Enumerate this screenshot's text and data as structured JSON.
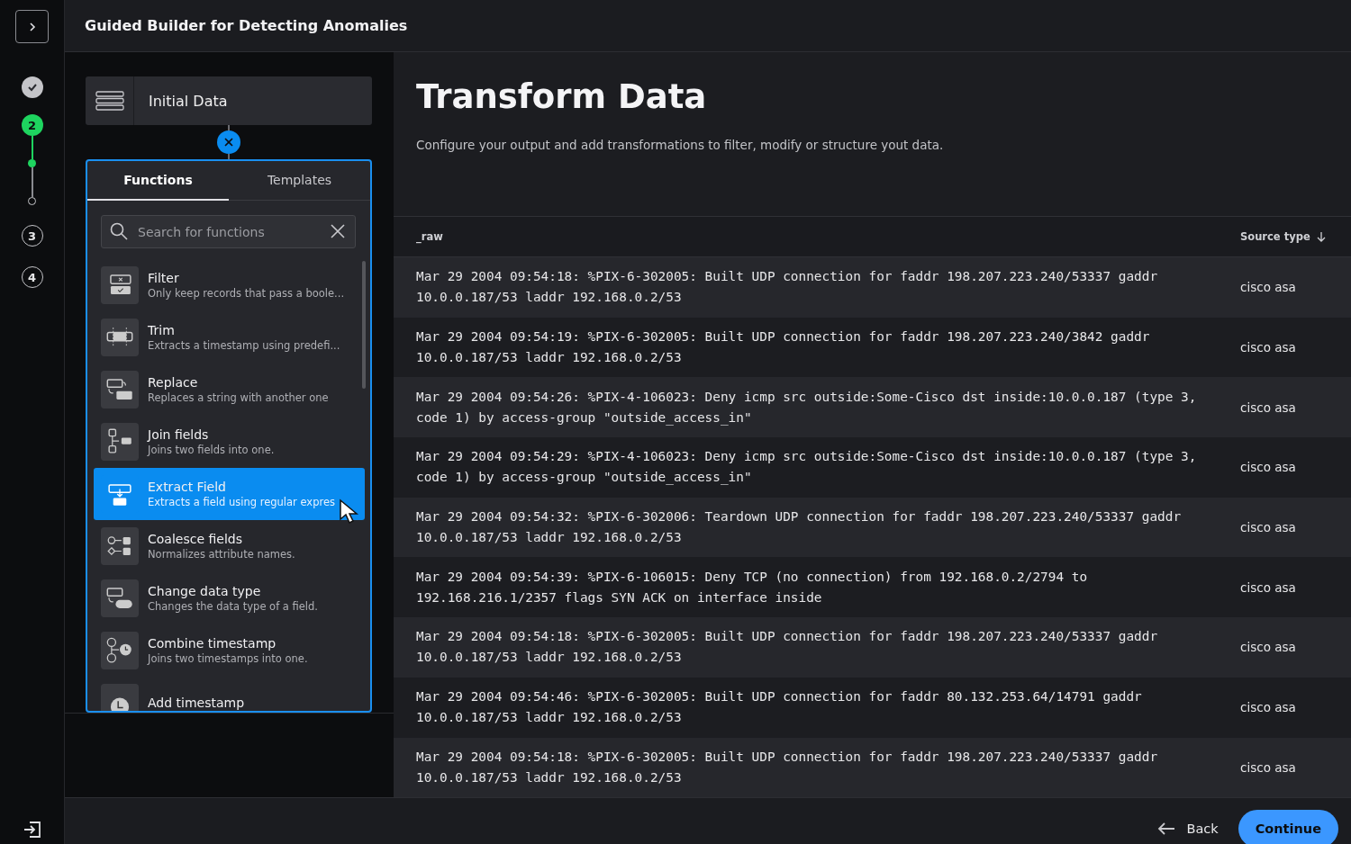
{
  "window": {
    "title": "Guided Builder for Detecting Anomalies"
  },
  "steps": [
    {
      "done": true,
      "selected": false
    },
    {
      "label": "2",
      "done": false,
      "selected": true,
      "children": [
        {
          "done": true
        },
        {
          "done": false
        }
      ]
    },
    {
      "label": "3",
      "done": false,
      "selected": false
    },
    {
      "label": "4",
      "done": false,
      "selected": false
    }
  ],
  "source_node": {
    "title": "Initial Data"
  },
  "tabs": [
    {
      "label": "Functions",
      "selected": true
    },
    {
      "label": "Templates",
      "selected": false
    }
  ],
  "search": {
    "placeholder": "Search for functions"
  },
  "functions": [
    {
      "name": "Filter",
      "description": "Only keep records that pass a boole...",
      "selected": false
    },
    {
      "name": "Trim",
      "description": "Extracts a timestamp using predefi...",
      "selected": false
    },
    {
      "name": "Replace",
      "description": "Replaces a string with another one",
      "selected": false
    },
    {
      "name": "Join fields",
      "description": "Joins two fields into one.",
      "selected": false
    },
    {
      "name": "Extract Field",
      "description": "Extracts a field using regular expres",
      "selected": true
    },
    {
      "name": "Coalesce fields",
      "description": "Normalizes attribute names.",
      "selected": false
    },
    {
      "name": "Change data type",
      "description": "Changes the data type of a field.",
      "selected": false
    },
    {
      "name": "Combine timestamp",
      "description": "Joins two timestamps into one.",
      "selected": false
    },
    {
      "name": "Add timestamp",
      "selected": false
    }
  ],
  "main": {
    "title": "Transform Data",
    "description": "Configure your output and add transformations to filter, modify or structure yout data."
  },
  "table": {
    "columns": [
      {
        "label": "_raw"
      },
      {
        "label": "Source type",
        "sort_descending": true
      }
    ],
    "rows": [
      {
        "raw": "Mar 29 2004 09:54:18: %PIX-6-302005: Built UDP connection for faddr 198.207.223.240/53337 gaddr 10.0.0.187/53 laddr 192.168.0.2/53",
        "source_type": "cisco asa"
      },
      {
        "raw": "Mar 29 2004 09:54:19: %PIX-6-302005: Built UDP connection for faddr 198.207.223.240/3842 gaddr 10.0.0.187/53 laddr 192.168.0.2/53",
        "source_type": "cisco asa"
      },
      {
        "raw": "Mar 29 2004 09:54:26: %PIX-4-106023: Deny icmp src outside:Some-Cisco dst inside:10.0.0.187 (type 3, code 1) by access-group \"outside_access_in\"",
        "source_type": "cisco asa"
      },
      {
        "raw": "Mar 29 2004 09:54:29: %PIX-4-106023: Deny icmp src outside:Some-Cisco dst inside:10.0.0.187 (type 3, code 1) by access-group \"outside_access_in\"",
        "source_type": "cisco asa"
      },
      {
        "raw": "Mar 29 2004 09:54:32: %PIX-6-302006: Teardown UDP connection for faddr 198.207.223.240/53337 gaddr 10.0.0.187/53 laddr 192.168.0.2/53",
        "source_type": "cisco asa"
      },
      {
        "raw": "Mar 29 2004 09:54:39: %PIX-6-106015: Deny TCP (no connection) from 192.168.0.2/2794 to 192.168.216.1/2357 flags SYN ACK on interface inside",
        "source_type": "cisco asa"
      },
      {
        "raw": "Mar 29 2004 09:54:18: %PIX-6-302005: Built UDP connection for faddr 198.207.223.240/53337 gaddr 10.0.0.187/53 laddr 192.168.0.2/53",
        "source_type": "cisco asa"
      },
      {
        "raw": "Mar 29 2004 09:54:46: %PIX-6-302005: Built UDP connection for faddr 80.132.253.64/14791 gaddr 10.0.0.187/53 laddr 192.168.0.2/53",
        "source_type": "cisco asa"
      },
      {
        "raw": "Mar 29 2004 09:54:18: %PIX-6-302005: Built UDP connection for faddr 198.207.223.240/53337 gaddr 10.0.0.187/53 laddr 192.168.0.2/53",
        "source_type": "cisco asa"
      }
    ]
  },
  "footer": {
    "back": "Back",
    "continue": "Continue"
  }
}
